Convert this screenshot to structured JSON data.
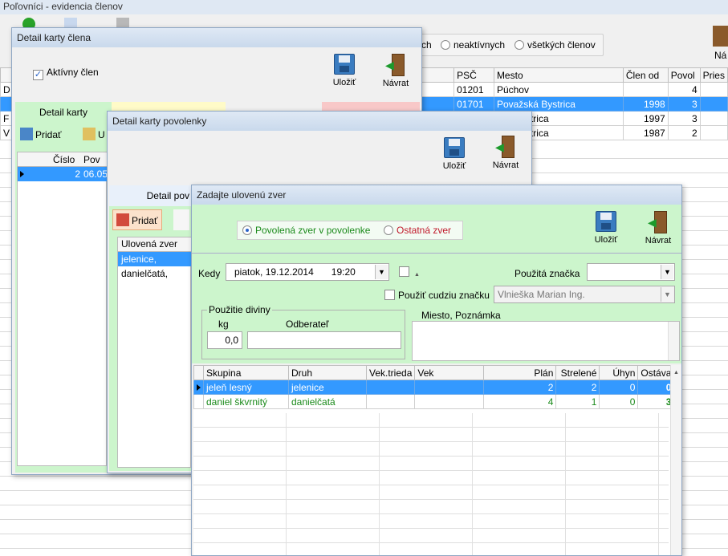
{
  "main": {
    "title": "Poľovníci  - evidencia členov",
    "filter": {
      "partial_label": "ch",
      "inactive_label": "neaktívnych",
      "all_label": "všetkých  členov"
    },
    "navrat_partial": "Ná",
    "columns": [
      "PSČ",
      "Mesto",
      "Člen od",
      "Povol",
      "Pries"
    ],
    "rows": [
      {
        "psc": "01201",
        "mesto": "Púchov",
        "clen_od": "",
        "povol": "4",
        "lead": "D"
      },
      {
        "psc": "01701",
        "mesto": "Považská Bystrica",
        "clen_od": "1998",
        "povol": "3",
        "lead": ""
      },
      {
        "psc": "",
        "mesto": "ská Bystrica",
        "clen_od": "1997",
        "povol": "3",
        "lead": "F"
      },
      {
        "psc": "",
        "mesto": "ská Bystrica",
        "clen_od": "1987",
        "povol": "2",
        "lead": "V"
      }
    ]
  },
  "win1": {
    "title": "Detail karty člena",
    "active_label": "Aktívny člen",
    "save_label": "Uložiť",
    "back_label": "Návrat",
    "tab_detail": "Detail karty",
    "add_label": "Pridať",
    "edit_partial": "U",
    "col_cislo": "Číslo",
    "col_pov": "Pov",
    "row_cislo": "2",
    "row_pov": "06.05"
  },
  "win2": {
    "title": "Detail karty povolenky",
    "save_label": "Uložiť",
    "back_label": "Návrat",
    "tab_partial": "Detail pov",
    "add_label": "Pridať",
    "col_zver": "Ulovená zver",
    "rows": [
      "jelenice,",
      "danielčatá,"
    ]
  },
  "win3": {
    "title": "Zadajte ulovenú zver",
    "radio_povolena": "Povolená zver v povolenke",
    "radio_ostatna": "Ostatná  zver",
    "save_label": "Uložiť",
    "back_label": "Návrat",
    "kedy_label": "Kedy",
    "kedy_day": "piatok",
    "kedy_date": ", 19.12.2014",
    "kedy_time": "19:20",
    "znacka_label": "Použitá značka",
    "cudzia_label": "Použiť cudziu značku",
    "cudzia_value": "Vlnieška Marian Ing.",
    "divina_group": "Použitie diviny",
    "kg_label": "kg",
    "kg_value": "0,0",
    "odberatel_label": "Odberateľ",
    "poznamka_label": "Miesto, Poznámka",
    "columns": [
      "Skupina",
      "Druh",
      "Vek.trieda",
      "Vek",
      "Plán",
      "Strelené",
      "Úhyn",
      "Ostáva"
    ],
    "rows": [
      {
        "skupina": "jeleň lesný",
        "druh": "jelenice",
        "vektrieda": "",
        "vek": "",
        "plan": "2",
        "strelene": "2",
        "uhyn": "0",
        "ostava": "0"
      },
      {
        "skupina": "daniel škvrnitý",
        "druh": "danielčatá",
        "vektrieda": "",
        "vek": "",
        "plan": "4",
        "strelene": "1",
        "uhyn": "0",
        "ostava": "3"
      }
    ]
  },
  "colors": {
    "selection": "#3399ff",
    "green_text": "#1a8a1a",
    "green_panel": "#ccf5cc"
  }
}
